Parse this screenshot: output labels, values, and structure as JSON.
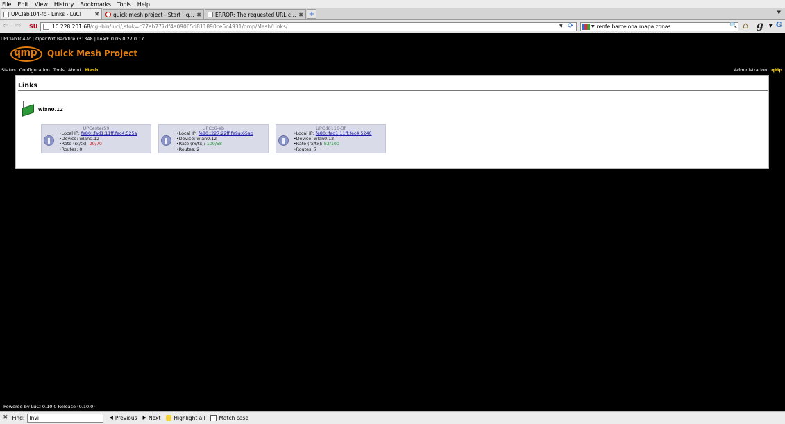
{
  "menubar": {
    "items": [
      "File",
      "Edit",
      "View",
      "History",
      "Bookmarks",
      "Tools",
      "Help"
    ]
  },
  "tabs": [
    {
      "label": "UPClab104-fc - Links - LuCI",
      "active": true
    },
    {
      "label": "quick mesh project - Start - q...",
      "active": false
    },
    {
      "label": "ERROR: The requested URL co...",
      "active": false
    }
  ],
  "tab_close_glyph": "✖",
  "new_tab_glyph": "+",
  "navbar": {
    "url_host": "10.228.201.68",
    "url_path": "/cgi-bin/luci/;stok=c77ab777df4a09065d811890ce5c4931/qmp/Mesh/Links/",
    "search_value": "renfe barcelona mapa zonas"
  },
  "page": {
    "host_info": "UPClab104-fc | OpenWrt Backfire r31348 | Load: 0.05 0.27 0.17",
    "logo_text": "qmp",
    "app_title": "Quick Mesh Project",
    "nav": [
      {
        "label": "Status",
        "active": false
      },
      {
        "label": "Configuration",
        "active": false
      },
      {
        "label": "Tools",
        "active": false
      },
      {
        "label": "About",
        "active": false
      },
      {
        "label": "Mesh",
        "active": true
      }
    ],
    "right_nav": [
      {
        "label": "Administration",
        "highlight": false
      },
      {
        "label": "qMp",
        "highlight": true
      }
    ],
    "heading": "Links",
    "interface": "wlan0.12",
    "nodes": [
      {
        "name": "UPCester59",
        "local_ip_label": "Local IP:",
        "local_ip": "fe80::fad1:11ff:fec4:525a",
        "device_label": "Device:",
        "device": "wlan0.12",
        "rate_label": "Rate (rx/tx):",
        "rate": "29/70",
        "rate_status": "bad",
        "routes_label": "Routes:",
        "routes": "0"
      },
      {
        "name": "UPCc6-ab",
        "local_ip_label": "Local IP:",
        "local_ip": "fe80::227:22ff:fe9a:65ab",
        "device_label": "Device:",
        "device": "wlan0.12",
        "rate_label": "Rate (rx/tx):",
        "rate": "100/58",
        "rate_status": "good",
        "routes_label": "Routes:",
        "routes": "2"
      },
      {
        "name": "UPCd6116-3f",
        "local_ip_label": "Local IP:",
        "local_ip": "fe80::fad1:11ff:fec4:5240",
        "device_label": "Device:",
        "device": "wlan0.12",
        "rate_label": "Rate (rx/tx):",
        "rate": "83/100",
        "rate_status": "good",
        "routes_label": "Routes:",
        "routes": "7"
      }
    ],
    "powered_by": "Powered by LuCI 0.10.0 Release (0.10.0)"
  },
  "findbar": {
    "label": "Find:",
    "value": "Invi",
    "previous": "Previous",
    "next": "Next",
    "highlight_all": "Highlight all",
    "match_case": "Match case"
  },
  "colors": {
    "brand_orange": "#e07d10",
    "nav_active": "#f0d000",
    "rate_bad": "#d91c1c",
    "rate_good": "#1a8f2a",
    "node_bg": "#d9dbe8"
  }
}
